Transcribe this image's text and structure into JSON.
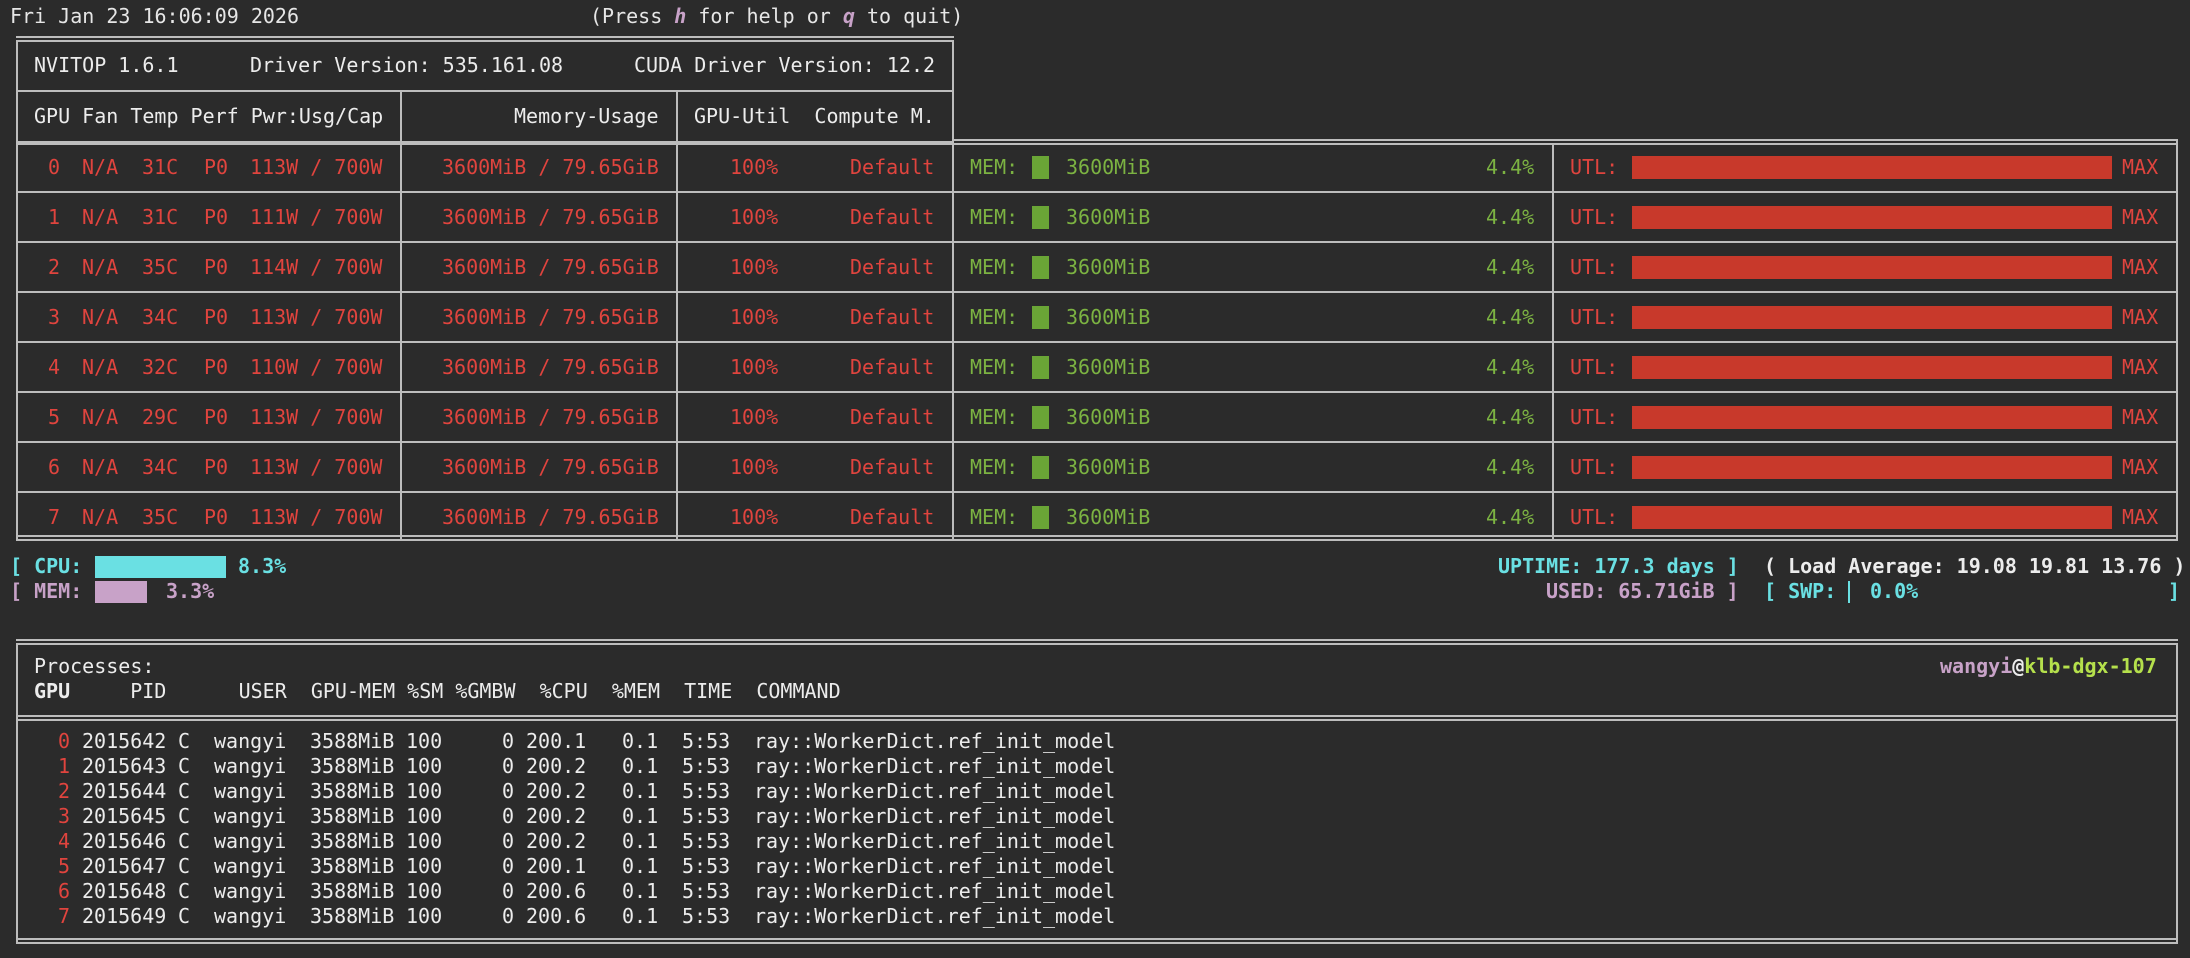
{
  "topbar": {
    "datetime": "Fri Jan 23 16:06:09 2026",
    "help_prefix": "(Press ",
    "help_key": "h",
    "help_mid": " for help or ",
    "quit_key": "q",
    "help_suffix": " to quit)"
  },
  "header": {
    "version": "NVITOP 1.6.1",
    "driver": "Driver Version: 535.161.08",
    "cuda": "CUDA Driver Version: 12.2",
    "col_left": "GPU Fan Temp Perf Pwr:Usg/Cap",
    "col_mem": "Memory-Usage",
    "col_util": "GPU-Util  Compute M."
  },
  "gpus": [
    {
      "id": "0",
      "fan": "N/A",
      "temp": "31C",
      "perf": "P0",
      "power": "113W / 700W",
      "memory": "3600MiB / 79.65GiB",
      "util": "100%",
      "compute": "Default",
      "mem_label": "MEM:",
      "mem_used": "3600MiB",
      "mem_pct": "4.4%",
      "utl_label": "UTL:",
      "utl_max": "MAX",
      "mem_fraction": 0.044,
      "util_fraction": 1.0
    },
    {
      "id": "1",
      "fan": "N/A",
      "temp": "31C",
      "perf": "P0",
      "power": "111W / 700W",
      "memory": "3600MiB / 79.65GiB",
      "util": "100%",
      "compute": "Default",
      "mem_label": "MEM:",
      "mem_used": "3600MiB",
      "mem_pct": "4.4%",
      "utl_label": "UTL:",
      "utl_max": "MAX",
      "mem_fraction": 0.044,
      "util_fraction": 1.0
    },
    {
      "id": "2",
      "fan": "N/A",
      "temp": "35C",
      "perf": "P0",
      "power": "114W / 700W",
      "memory": "3600MiB / 79.65GiB",
      "util": "100%",
      "compute": "Default",
      "mem_label": "MEM:",
      "mem_used": "3600MiB",
      "mem_pct": "4.4%",
      "utl_label": "UTL:",
      "utl_max": "MAX",
      "mem_fraction": 0.044,
      "util_fraction": 1.0
    },
    {
      "id": "3",
      "fan": "N/A",
      "temp": "34C",
      "perf": "P0",
      "power": "113W / 700W",
      "memory": "3600MiB / 79.65GiB",
      "util": "100%",
      "compute": "Default",
      "mem_label": "MEM:",
      "mem_used": "3600MiB",
      "mem_pct": "4.4%",
      "utl_label": "UTL:",
      "utl_max": "MAX",
      "mem_fraction": 0.044,
      "util_fraction": 1.0
    },
    {
      "id": "4",
      "fan": "N/A",
      "temp": "32C",
      "perf": "P0",
      "power": "110W / 700W",
      "memory": "3600MiB / 79.65GiB",
      "util": "100%",
      "compute": "Default",
      "mem_label": "MEM:",
      "mem_used": "3600MiB",
      "mem_pct": "4.4%",
      "utl_label": "UTL:",
      "utl_max": "MAX",
      "mem_fraction": 0.044,
      "util_fraction": 1.0
    },
    {
      "id": "5",
      "fan": "N/A",
      "temp": "29C",
      "perf": "P0",
      "power": "113W / 700W",
      "memory": "3600MiB / 79.65GiB",
      "util": "100%",
      "compute": "Default",
      "mem_label": "MEM:",
      "mem_used": "3600MiB",
      "mem_pct": "4.4%",
      "utl_label": "UTL:",
      "utl_max": "MAX",
      "mem_fraction": 0.044,
      "util_fraction": 1.0
    },
    {
      "id": "6",
      "fan": "N/A",
      "temp": "34C",
      "perf": "P0",
      "power": "113W / 700W",
      "memory": "3600MiB / 79.65GiB",
      "util": "100%",
      "compute": "Default",
      "mem_label": "MEM:",
      "mem_used": "3600MiB",
      "mem_pct": "4.4%",
      "utl_label": "UTL:",
      "utl_max": "MAX",
      "mem_fraction": 0.044,
      "util_fraction": 1.0
    },
    {
      "id": "7",
      "fan": "N/A",
      "temp": "35C",
      "perf": "P0",
      "power": "113W / 700W",
      "memory": "3600MiB / 79.65GiB",
      "util": "100%",
      "compute": "Default",
      "mem_label": "MEM:",
      "mem_used": "3600MiB",
      "mem_pct": "4.4%",
      "utl_label": "UTL:",
      "utl_max": "MAX",
      "mem_fraction": 0.044,
      "util_fraction": 1.0
    }
  ],
  "host": {
    "cpu_open": "[ CPU:",
    "cpu_pct": "8.3%",
    "cpu_fraction": 0.083,
    "mem_open": "[ MEM:",
    "mem_pct": "3.3%",
    "mem_fraction": 0.033,
    "uptime": "UPTIME: 177.3 days ]",
    "load_average": "( Load Average: 19.08 19.81 13.76 )",
    "used": "USED: 65.71GiB ]",
    "swp_open": "[ SWP:",
    "swp_pct": "0.0%",
    "swp_close": "]"
  },
  "processes": {
    "title": "Processes:",
    "user": "wangyi",
    "at": "@",
    "hostname": "klb-dgx-107",
    "headers": {
      "gpu": "GPU",
      "rest": "     PID      USER  GPU-MEM %SM %GMBW  %CPU  %MEM  TIME  COMMAND"
    },
    "rows": [
      {
        "gpu": "0",
        "pid": "2015642",
        "type": "C",
        "user": "wangyi",
        "gpu_mem": "3588MiB",
        "sm": "100",
        "gmbw": "0",
        "cpu": "200.1",
        "mem": "0.1",
        "time": "5:53",
        "command": "ray::WorkerDict.ref_init_model"
      },
      {
        "gpu": "1",
        "pid": "2015643",
        "type": "C",
        "user": "wangyi",
        "gpu_mem": "3588MiB",
        "sm": "100",
        "gmbw": "0",
        "cpu": "200.2",
        "mem": "0.1",
        "time": "5:53",
        "command": "ray::WorkerDict.ref_init_model"
      },
      {
        "gpu": "2",
        "pid": "2015644",
        "type": "C",
        "user": "wangyi",
        "gpu_mem": "3588MiB",
        "sm": "100",
        "gmbw": "0",
        "cpu": "200.2",
        "mem": "0.1",
        "time": "5:53",
        "command": "ray::WorkerDict.ref_init_model"
      },
      {
        "gpu": "3",
        "pid": "2015645",
        "type": "C",
        "user": "wangyi",
        "gpu_mem": "3588MiB",
        "sm": "100",
        "gmbw": "0",
        "cpu": "200.2",
        "mem": "0.1",
        "time": "5:53",
        "command": "ray::WorkerDict.ref_init_model"
      },
      {
        "gpu": "4",
        "pid": "2015646",
        "type": "C",
        "user": "wangyi",
        "gpu_mem": "3588MiB",
        "sm": "100",
        "gmbw": "0",
        "cpu": "200.2",
        "mem": "0.1",
        "time": "5:53",
        "command": "ray::WorkerDict.ref_init_model"
      },
      {
        "gpu": "5",
        "pid": "2015647",
        "type": "C",
        "user": "wangyi",
        "gpu_mem": "3588MiB",
        "sm": "100",
        "gmbw": "0",
        "cpu": "200.1",
        "mem": "0.1",
        "time": "5:53",
        "command": "ray::WorkerDict.ref_init_model"
      },
      {
        "gpu": "6",
        "pid": "2015648",
        "type": "C",
        "user": "wangyi",
        "gpu_mem": "3588MiB",
        "sm": "100",
        "gmbw": "0",
        "cpu": "200.6",
        "mem": "0.1",
        "time": "5:53",
        "command": "ray::WorkerDict.ref_init_model"
      },
      {
        "gpu": "7",
        "pid": "2015649",
        "type": "C",
        "user": "wangyi",
        "gpu_mem": "3588MiB",
        "sm": "100",
        "gmbw": "0",
        "cpu": "200.6",
        "mem": "0.1",
        "time": "5:53",
        "command": "ray::WorkerDict.ref_init_model"
      }
    ]
  },
  "colors": {
    "background": "#2b2b2b",
    "red": "#e0443e",
    "green": "#7cb342",
    "cyan": "#6ae0e3",
    "pink": "#c8a2c8",
    "bar_red": "#c8392b",
    "bar_green": "#6aa536"
  }
}
